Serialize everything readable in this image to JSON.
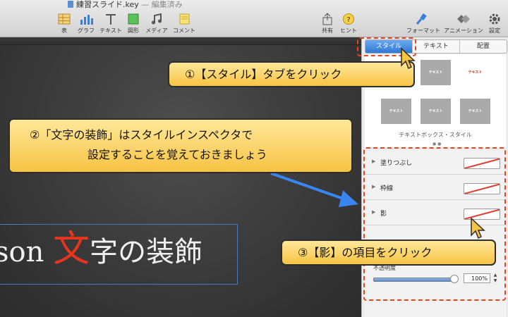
{
  "window": {
    "title": "練習スライド.key",
    "separator": " — ",
    "status": "編集済み"
  },
  "toolbar": {
    "left": [
      {
        "icon": "table-icon",
        "label": "表"
      },
      {
        "icon": "chart-icon",
        "label": "グラフ"
      },
      {
        "icon": "text-icon",
        "label": "テキスト"
      },
      {
        "icon": "shape-icon",
        "label": "図形"
      },
      {
        "icon": "media-icon",
        "label": "メディア"
      },
      {
        "icon": "comment-icon",
        "label": "コメント"
      }
    ],
    "right": [
      {
        "icon": "share-icon",
        "label": "共有"
      },
      {
        "icon": "hint-icon",
        "label": "ヒント"
      },
      {
        "icon": "format-icon",
        "label": "フォーマット"
      },
      {
        "icon": "animation-icon",
        "label": "アニメーション"
      },
      {
        "icon": "settings-icon",
        "label": "設定"
      }
    ]
  },
  "slide": {
    "text_prefix": "son",
    "text_big": "文",
    "text_rest": "字の装飾"
  },
  "inspector": {
    "tabs": [
      "スタイル",
      "テキスト",
      "配置"
    ],
    "active_tab": 0,
    "swatches": [
      "テキスト",
      "テキスト",
      "テキスト",
      "テキスト",
      "テキスト"
    ],
    "caption": "テキストボックス・スタイル",
    "dots": "● ●",
    "sections": [
      {
        "name": "塗りつぶし"
      },
      {
        "name": "枠線"
      },
      {
        "name": "影"
      }
    ],
    "opacity_label": "不透明度",
    "opacity_value": "100%",
    "opacity_fraction": 1.0
  },
  "annotations": {
    "step1": "①【スタイル】タブをクリック",
    "step2_line1": "②「文字の装飾」はスタイルインスペクタで",
    "step2_line2": "設定することを覚えておきましょう",
    "step3": "③【影】の項目をクリック",
    "colors": {
      "dash": "#e5441f",
      "callout": "#f7c343",
      "arrow": "#3a86f0"
    }
  }
}
